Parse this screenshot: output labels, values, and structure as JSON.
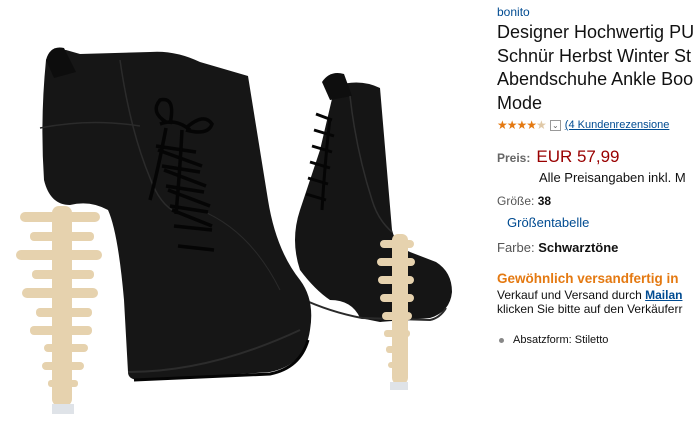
{
  "product": {
    "brand": "bonito",
    "title_lines": [
      "Designer Hochwertig PU",
      "Schnür Herbst Winter St",
      "Abendschuhe Ankle Boo",
      "Mode"
    ],
    "rating": 4,
    "rating_max": 5,
    "reviews_link": "(4 Kundenrezensione",
    "price_label": "Preis:",
    "price": "EUR 57,99",
    "price_note": "Alle Preisangaben inkl. M",
    "size_label": "Größe:",
    "size_value": "38",
    "size_chart_link": "Größentabelle",
    "color_label": "Farbe:",
    "color_value": "Schwarztöne",
    "shipping_status": "Gewöhnlich versandfertig in",
    "seller_line_prefix": "Verkauf und Versand durch",
    "seller_name": "Mailan",
    "seller_line2": "klicken Sie bitte auf den Verkäuferr",
    "feature": "Absatzform: Stiletto"
  },
  "colors": {
    "link": "#004b91",
    "price": "#990000",
    "accent": "#e47911",
    "boot": "#151515",
    "heel": "#e6d2ae"
  },
  "icons": {
    "stars": "star-rating-icon",
    "dropdown": "chevron-down-icon",
    "bullet": "bullet-icon"
  }
}
